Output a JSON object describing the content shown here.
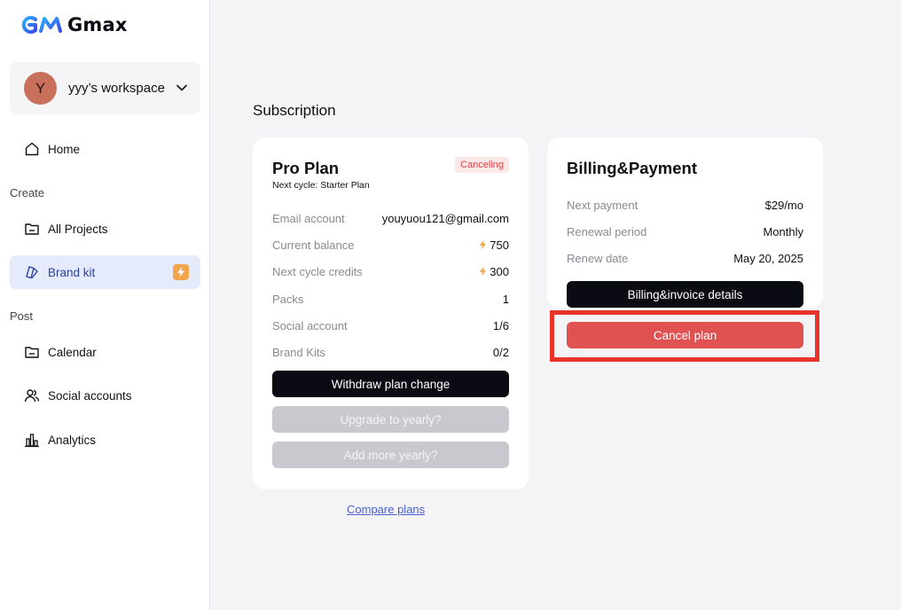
{
  "brand": {
    "name": "Gmax"
  },
  "workspace": {
    "avatar_letter": "Y",
    "name": "yyy’s workspace"
  },
  "nav": {
    "home": "Home",
    "create_section": "Create",
    "all_projects": "All Projects",
    "brand_kit": "Brand kit",
    "post_section": "Post",
    "calendar": "Calendar",
    "social_accounts": "Social accounts",
    "analytics": "Analytics"
  },
  "page": {
    "title": "Subscription"
  },
  "plan": {
    "name": "Pro Plan",
    "next_cycle": "Next cycle: Starter Plan",
    "status": "Canceling",
    "rows": [
      {
        "label": "Email account",
        "value": "youyuou121@gmail.com"
      },
      {
        "label": "Current balance",
        "value": "750"
      },
      {
        "label": "Next cycle credits",
        "value": "300"
      },
      {
        "label": "Packs",
        "value": "1"
      },
      {
        "label": "Social account",
        "value": "1/6"
      },
      {
        "label": "Brand Kits",
        "value": "0/2"
      }
    ],
    "withdraw_label": "Withdraw plan change",
    "upgrade_label": "Upgrade to yearly?",
    "add_more_label": "Add more yearly?"
  },
  "billing": {
    "title": "Billing&Payment",
    "rows": [
      {
        "label": "Next payment",
        "value": "$29/mo"
      },
      {
        "label": "Renewal period",
        "value": "Monthly"
      },
      {
        "label": "Renew date",
        "value": "May 20, 2025"
      }
    ],
    "details_label": "Billing&invoice details",
    "cancel_label": "Cancel plan"
  },
  "compare_link": "Compare plans",
  "colors": {
    "accent": "#2a3fa0",
    "danger": "#e05252",
    "highlight": "#e8342a",
    "bolt": "#f2a54a"
  }
}
